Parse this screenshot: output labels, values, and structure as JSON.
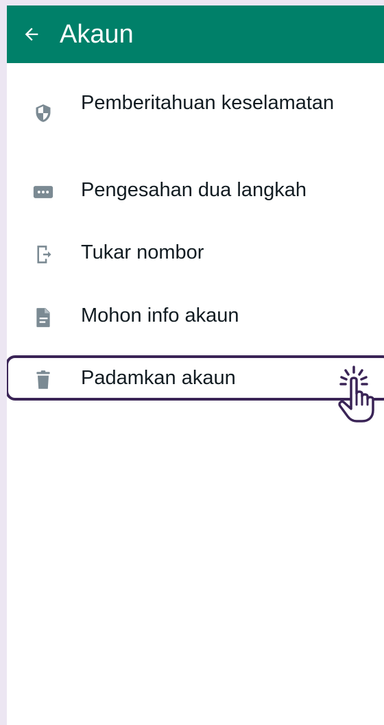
{
  "appbar": {
    "title": "Akaun",
    "back_icon": "arrow-left-icon",
    "color": "#008069"
  },
  "menu": {
    "items": [
      {
        "label": "Pemberitahuan keselamatan",
        "icon": "shield-icon"
      },
      {
        "label": "Pengesahan dua langkah",
        "icon": "dots-keypad-icon"
      },
      {
        "label": "Tukar nombor",
        "icon": "phone-transfer-icon"
      },
      {
        "label": "Mohon info akaun",
        "icon": "document-icon"
      },
      {
        "label": "Padamkan akaun",
        "icon": "trash-icon"
      }
    ]
  },
  "highlight": {
    "target": "Padamkan akaun",
    "color": "#3a2456"
  },
  "cursor": {
    "icon": "hand-pointer-click-icon"
  }
}
